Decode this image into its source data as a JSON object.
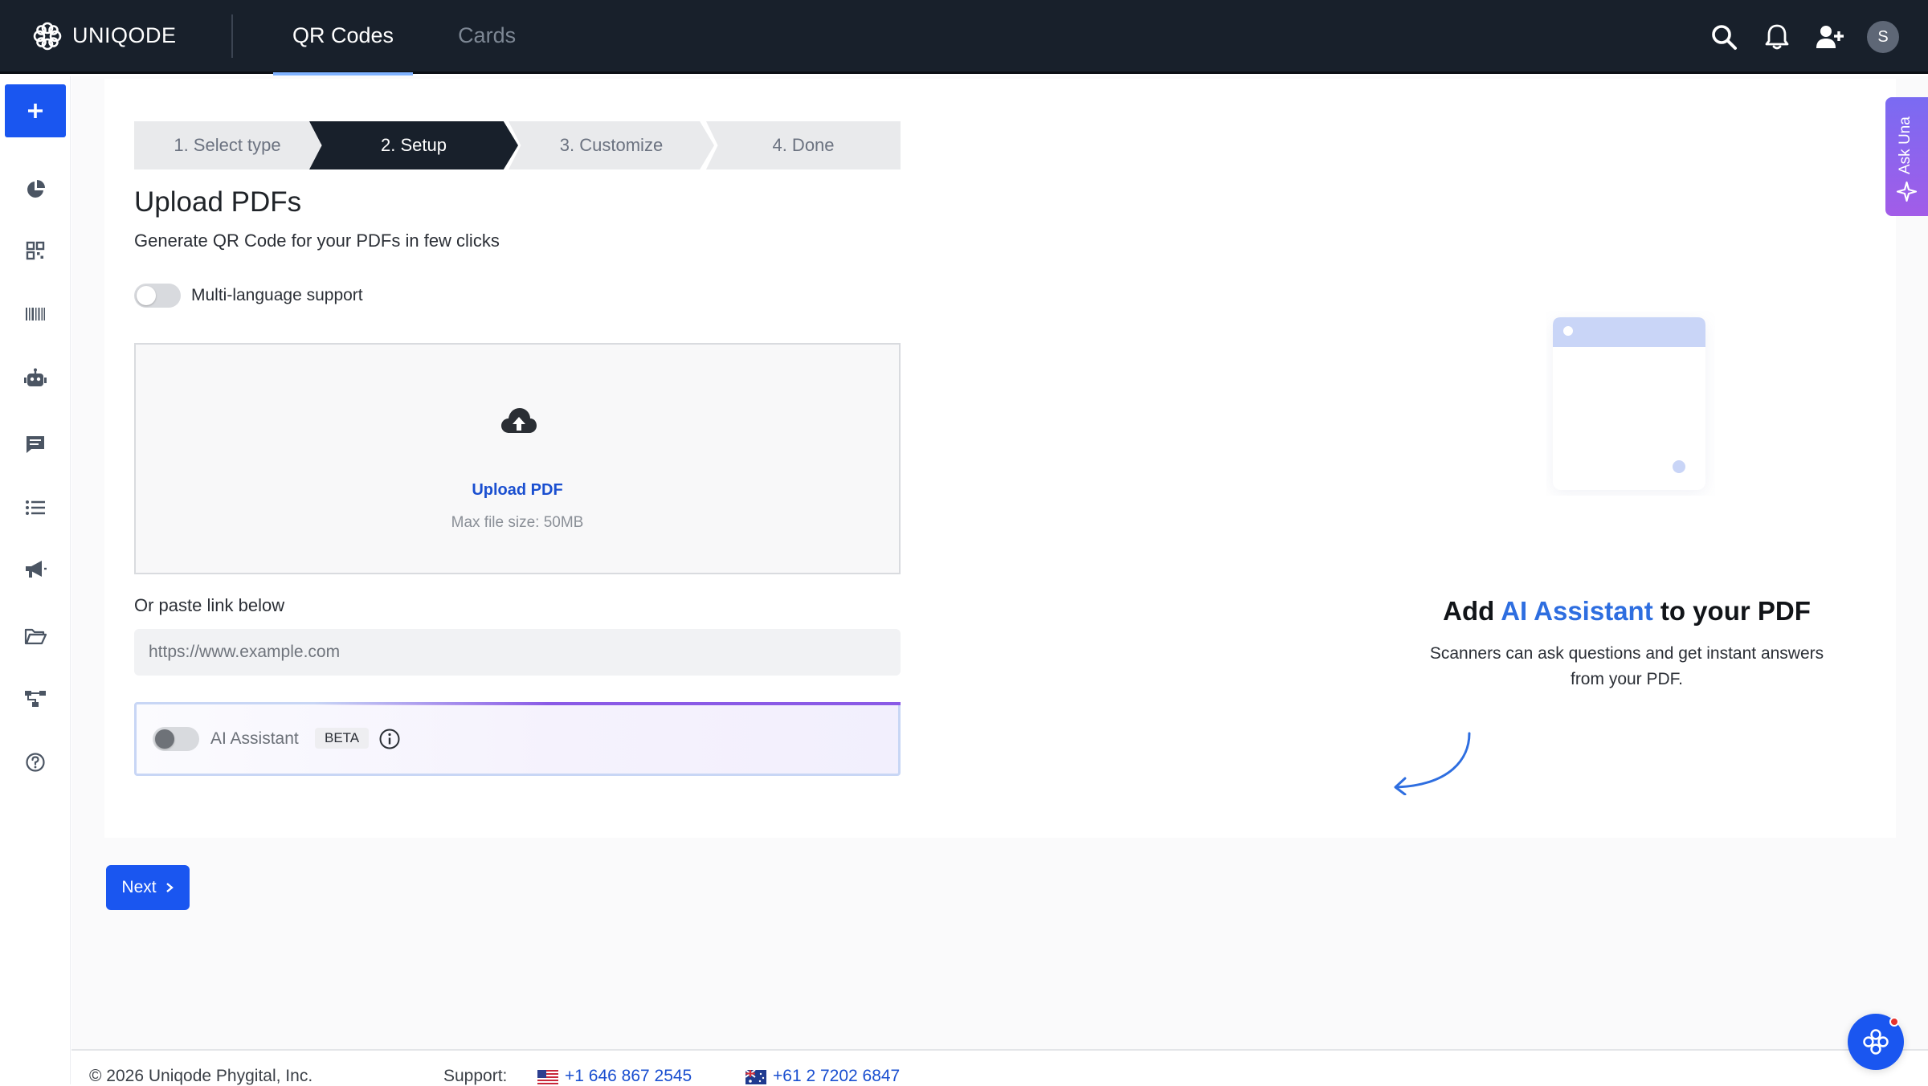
{
  "brand": {
    "name": "UNIQODE"
  },
  "nav": {
    "tabs": [
      {
        "label": "QR Codes",
        "active": true
      },
      {
        "label": "Cards",
        "active": false
      }
    ]
  },
  "topbar": {
    "avatar_initial": "S",
    "icons": [
      "search-icon",
      "bell-icon",
      "add-user-icon"
    ]
  },
  "sidebar": {
    "create_icon": "plus-icon",
    "items": [
      "analytics-icon",
      "qr-code-icon",
      "barcode-icon",
      "bot-icon",
      "message-icon",
      "list-icon",
      "megaphone-icon",
      "folder-icon",
      "workflow-icon",
      "help-icon"
    ]
  },
  "stepper": {
    "steps": [
      "1. Select type",
      "2. Setup",
      "3. Customize",
      "4. Done"
    ],
    "active_index": 1
  },
  "page": {
    "title": "Upload PDFs",
    "subtitle": "Generate QR Code for your PDFs in few clicks"
  },
  "multi_language": {
    "label": "Multi-language support",
    "enabled": false
  },
  "upload": {
    "link_label": "Upload PDF",
    "hint": "Max file size: 50MB"
  },
  "paste": {
    "label": "Or paste link below",
    "placeholder": "https://www.example.com"
  },
  "ai_assistant": {
    "label": "AI Assistant",
    "badge": "BETA",
    "enabled": false
  },
  "actions": {
    "next_label": "Next"
  },
  "promo": {
    "title_prefix": "Add ",
    "title_highlight": "AI Assistant",
    "title_suffix": " to your PDF",
    "description": "Scanners can ask questions and get instant answers from your PDF.",
    "highlight_color": "#2e6ee0"
  },
  "ask_una": {
    "label": "Ask Una"
  },
  "footer": {
    "copyright": "© 2026 Uniqode Phygital, Inc.",
    "support_label": "Support:",
    "phone_us": "+1 646 867 2545",
    "phone_au": "+61 2 7202 6847"
  },
  "colors": {
    "primary": "#1a56f0",
    "topbar": "#18202b",
    "link": "#1a4fd0",
    "purple_accent": "#8a5ae6"
  }
}
